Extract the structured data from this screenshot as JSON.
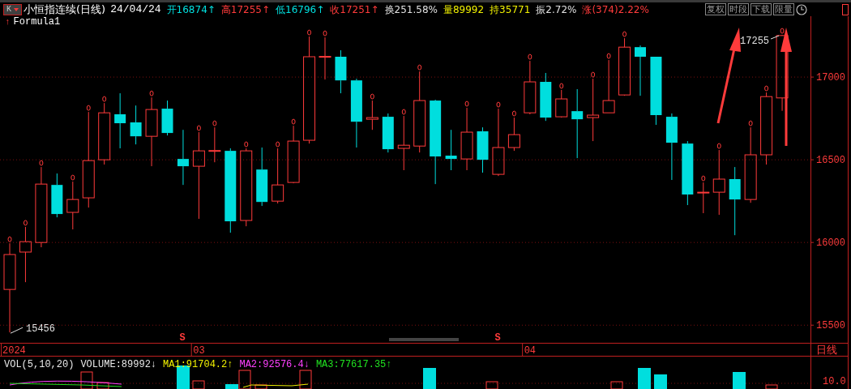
{
  "header": {
    "mode_button": "K",
    "title": "小恒指连续(日线)",
    "date": "24/04/24",
    "fields": [
      {
        "label": "开",
        "value": "16874",
        "arrow": "↑",
        "color": "#00e0e0"
      },
      {
        "label": "高",
        "value": "17255",
        "arrow": "↑",
        "color": "#ff3b3b"
      },
      {
        "label": "低",
        "value": "16796",
        "arrow": "↑",
        "color": "#00e0e0"
      },
      {
        "label": "收",
        "value": "17251",
        "arrow": "↑",
        "color": "#ff3b3b"
      },
      {
        "label": "换",
        "value": "251.58%",
        "color": "#e0e0e0"
      },
      {
        "label": "量",
        "value": "89992",
        "color": "#f0f000"
      },
      {
        "label": "持",
        "value": "35771",
        "color": "#f0f000"
      },
      {
        "label": "振",
        "value": "2.72%",
        "color": "#e0e0e0"
      },
      {
        "label": "涨",
        "value": "(374)2.22%",
        "color": "#ff3b3b"
      }
    ],
    "tool_buttons": [
      "复权",
      "时段",
      "下载",
      "限量"
    ]
  },
  "formula": {
    "arrow": "↑",
    "name": "Formula1"
  },
  "chart_data": {
    "type": "candlestick",
    "yticks": [
      15500,
      16000,
      16500,
      17000
    ],
    "ylim": [
      15114,
      17368
    ],
    "grid": true,
    "categories": [
      "2024",
      null,
      null,
      null,
      null,
      null,
      null,
      null,
      null,
      null,
      null,
      null,
      "03",
      null,
      null,
      null,
      null,
      null,
      null,
      null,
      null,
      null,
      null,
      null,
      null,
      null,
      null,
      null,
      null,
      null,
      null,
      null,
      null,
      "04",
      null,
      null,
      null,
      null,
      null,
      null,
      null,
      null,
      null,
      null,
      null,
      null,
      null,
      null,
      null,
      null
    ],
    "annotations": [
      {
        "text": "17255"
      },
      {
        "text": "15456"
      }
    ],
    "ohlc": [
      [
        15716,
        15995,
        15456,
        15927
      ],
      [
        15942,
        16094,
        15760,
        16005
      ],
      [
        16000,
        16456,
        15971,
        16353
      ],
      [
        16348,
        16417,
        16152,
        16172
      ],
      [
        16182,
        16368,
        16079,
        16260
      ],
      [
        16270,
        16789,
        16211,
        16495
      ],
      [
        16500,
        16843,
        16471,
        16784
      ],
      [
        16775,
        16902,
        16569,
        16721
      ],
      [
        16726,
        16828,
        16593,
        16642
      ],
      [
        16642,
        16877,
        16461,
        16804
      ],
      [
        16809,
        16858,
        16647,
        16662
      ],
      [
        16505,
        16681,
        16348,
        16461
      ],
      [
        16461,
        16667,
        16143,
        16554
      ],
      [
        16554,
        16696,
        16485,
        16556
      ],
      [
        16554,
        16569,
        16059,
        16128
      ],
      [
        16133,
        16569,
        16098,
        16554
      ],
      [
        16441,
        16574,
        16221,
        16245
      ],
      [
        16250,
        16569,
        16236,
        16348
      ],
      [
        16363,
        16706,
        16358,
        16613
      ],
      [
        16618,
        17245,
        16598,
        17123
      ],
      [
        17123,
        17240,
        16985,
        17125
      ],
      [
        17123,
        17162,
        16902,
        16980
      ],
      [
        16980,
        16990,
        16574,
        16730
      ],
      [
        16745,
        16858,
        16681,
        16755
      ],
      [
        16760,
        16780,
        16544,
        16564
      ],
      [
        16569,
        16765,
        16437,
        16588
      ],
      [
        16583,
        17034,
        16544,
        16858
      ],
      [
        16858,
        16863,
        16353,
        16520
      ],
      [
        16525,
        16681,
        16437,
        16505
      ],
      [
        16505,
        16814,
        16437,
        16667
      ],
      [
        16672,
        16696,
        16422,
        16500
      ],
      [
        16412,
        16809,
        16402,
        16574
      ],
      [
        16574,
        16755,
        16554,
        16652
      ],
      [
        16784,
        17098,
        16775,
        16971
      ],
      [
        16971,
        17025,
        16735,
        16755
      ],
      [
        16760,
        16922,
        16755,
        16868
      ],
      [
        16794,
        16927,
        16510,
        16745
      ],
      [
        16755,
        16990,
        16613,
        16770
      ],
      [
        16784,
        17103,
        16784,
        16858
      ],
      [
        16892,
        17235,
        16887,
        17181
      ],
      [
        17181,
        17191,
        16887,
        17123
      ],
      [
        17123,
        17123,
        16711,
        16770
      ],
      [
        16760,
        16780,
        16378,
        16603
      ],
      [
        16598,
        16613,
        16226,
        16290
      ],
      [
        16299,
        16363,
        16177,
        16304
      ],
      [
        16304,
        16559,
        16167,
        16383
      ],
      [
        16383,
        16456,
        16044,
        16260
      ],
      [
        16260,
        16696,
        16240,
        16530
      ],
      [
        16530,
        16907,
        16471,
        16882
      ],
      [
        16874,
        17255,
        16796,
        17251
      ]
    ]
  },
  "signal_marks": [
    "S",
    "S"
  ],
  "period_label": "日线",
  "volume": {
    "title": "VOL(5,10,20)",
    "stats": [
      {
        "text": "VOLUME:89992",
        "arrow": "↓",
        "color": "#e8e8e8"
      },
      {
        "text": "MA1:91704.2",
        "arrow": "↑",
        "color": "#f0f000"
      },
      {
        "text": "MA2:92576.4",
        "arrow": "↓",
        "color": "#ff40ff"
      },
      {
        "text": "MA3:77617.35",
        "arrow": "↑",
        "color": "#20e020"
      }
    ],
    "axis_label": "10.0"
  }
}
